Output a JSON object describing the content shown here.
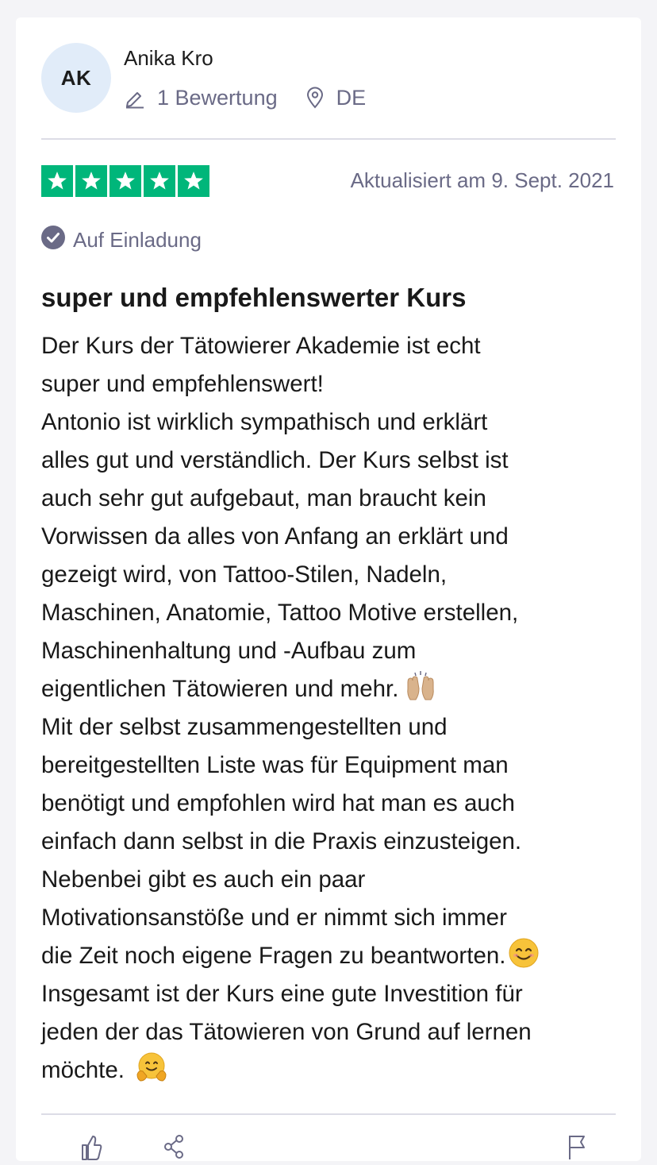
{
  "reviewer": {
    "initials": "AK",
    "name": "Anika Kro",
    "review_count": "1 Bewertung",
    "country": "DE"
  },
  "review": {
    "rating": 5,
    "date": "Aktualisiert am 9. Sept. 2021",
    "invited_label": "Auf Einladung",
    "title": "super und empfehlenswerter Kurs",
    "lines": [
      "Der Kurs der Tätowierer Akademie ist echt",
      "super und empfehlenswert!",
      "Antonio ist wirklich sympathisch und erklärt",
      "alles gut und verständlich. Der Kurs selbst ist",
      "auch sehr gut aufgebaut, man braucht kein",
      "Vorwissen da alles von Anfang an erklärt und",
      "gezeigt wird, von Tattoo-Stilen, Nadeln,",
      "Maschinen, Anatomie, Tattoo Motive erstellen,",
      "Maschinenhaltung und -Aufbau zum",
      "eigentlichen Tätowieren und mehr.",
      "Mit der selbst zusammengestellten und",
      "bereitgestellten Liste was für Equipment man",
      "benötigt und empfohlen wird hat man es auch",
      "einfach dann selbst in die Praxis einzusteigen.",
      "Nebenbei gibt es auch ein paar",
      "Motivationsanstöße und er nimmt sich immer",
      "die Zeit noch eigene Fragen zu beantworten.",
      "Insgesamt ist der Kurs eine gute Investition für",
      "jeden der das Tätowieren von Grund auf lernen",
      "möchte."
    ]
  },
  "icons": {
    "review_count": "pencil-icon",
    "country": "location-pin-icon",
    "invited": "check-circle-icon",
    "emoji_hands": "raised-hands-emoji",
    "emoji_smile": "smiling-face-emoji",
    "emoji_hug": "hugging-face-emoji",
    "useful": "thumbs-up-icon",
    "share": "share-icon",
    "report": "flag-icon"
  },
  "colors": {
    "star_green": "#00b67a",
    "meta_gray": "#6a6a86",
    "avatar_bg": "#e1ecf9"
  }
}
